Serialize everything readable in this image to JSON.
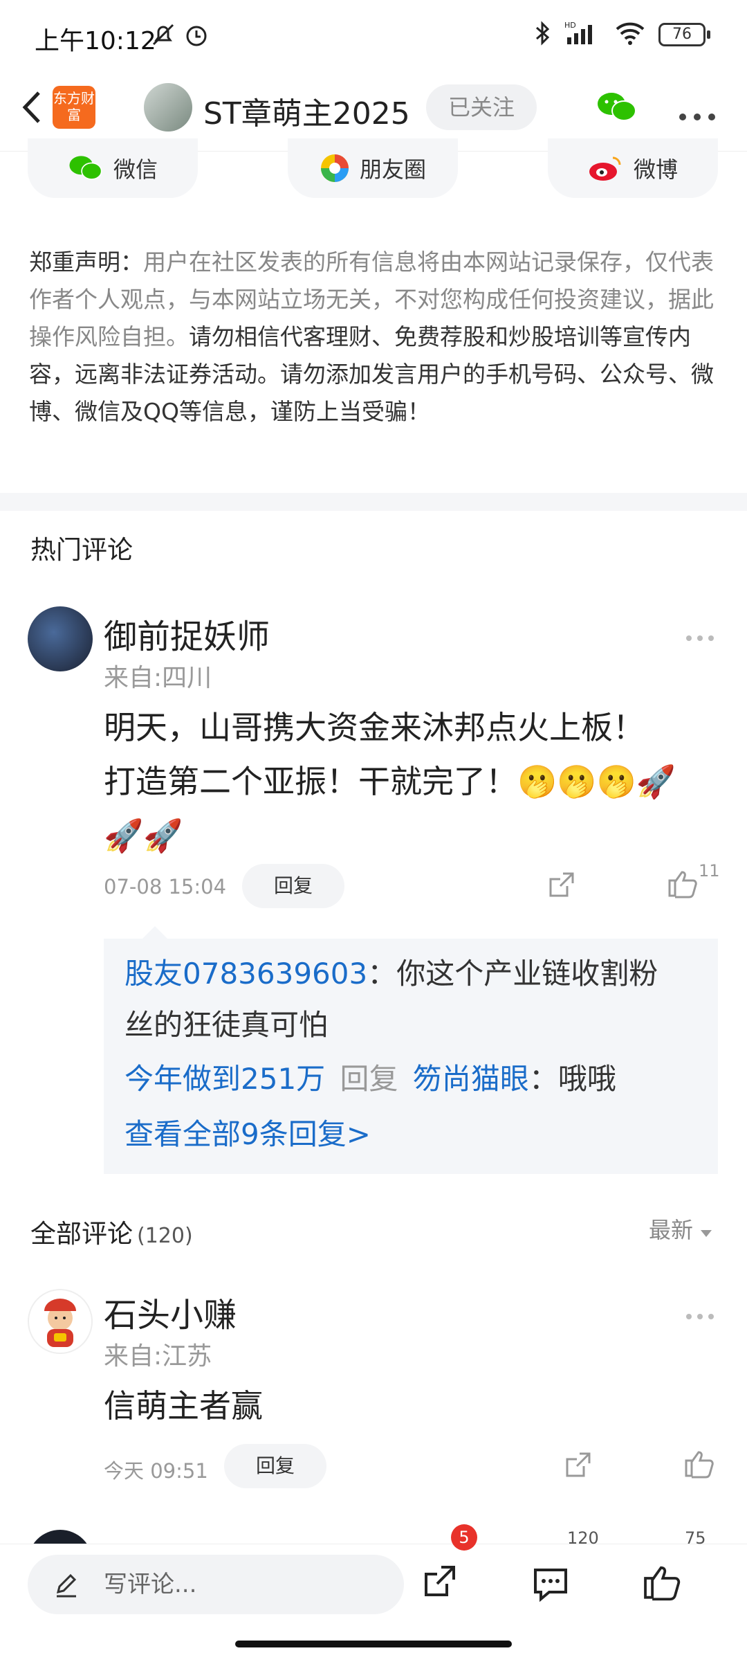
{
  "status_bar": {
    "time": "上午10:12",
    "battery": "76"
  },
  "header": {
    "logo_text": "东方财富",
    "author_name": "ST章萌主2025",
    "follow_label": "已关注"
  },
  "share": [
    {
      "label": "微信",
      "icon": "wechat-icon"
    },
    {
      "label": "朋友圈",
      "icon": "moments-icon"
    },
    {
      "label": "微博",
      "icon": "weibo-icon"
    }
  ],
  "disclaimer": {
    "title": "郑重声明：",
    "normal": "用户在社区发表的所有信息将由本网站记录保存，仅代表作者个人观点，与本网站立场无关，不对您构成任何投资建议，据此操作风险自担。",
    "bold": "请勿相信代客理财、免费荐股和炒股培训等宣传内容，远离非法证券活动。请勿添加发言用户的手机号码、公众号、微博、微信及QQ等信息，谨防上当受骗！"
  },
  "hot_comments": {
    "title": "热门评论",
    "comment": {
      "user": "御前捉妖师",
      "location": "来自:四川",
      "line1": "明天，山哥携大资金来沐邦点火上板！",
      "line2": "打造第二个亚振！干就完了！",
      "emojis1": "🫢🫢🫢🚀",
      "emojis2": "🚀🚀",
      "time": "07-08 15:04",
      "reply_label": "回复",
      "likes": "11",
      "replies": {
        "r1_user": "股友0783639603",
        "r1_text_a": "：你这个产业链收割粉",
        "r1_text_b": "丝的狂徒真可怕",
        "r2_user": "今年做到251万",
        "r2_reply": "回复",
        "r2_target": "笏尚猫眼",
        "r2_text": "：哦哦",
        "view_all": "查看全部9条回复>"
      }
    }
  },
  "all_comments": {
    "title": "全部评论",
    "count": "(120)",
    "sort": "最新",
    "comment": {
      "user": "石头小赚",
      "location": "来自:江苏",
      "text": "信萌主者赢",
      "time": "今天 09:51",
      "reply_label": "回复"
    }
  },
  "bottom_bar": {
    "input_placeholder": "写评论...",
    "share_badge": "5",
    "comment_count": "120",
    "like_count": "75"
  }
}
